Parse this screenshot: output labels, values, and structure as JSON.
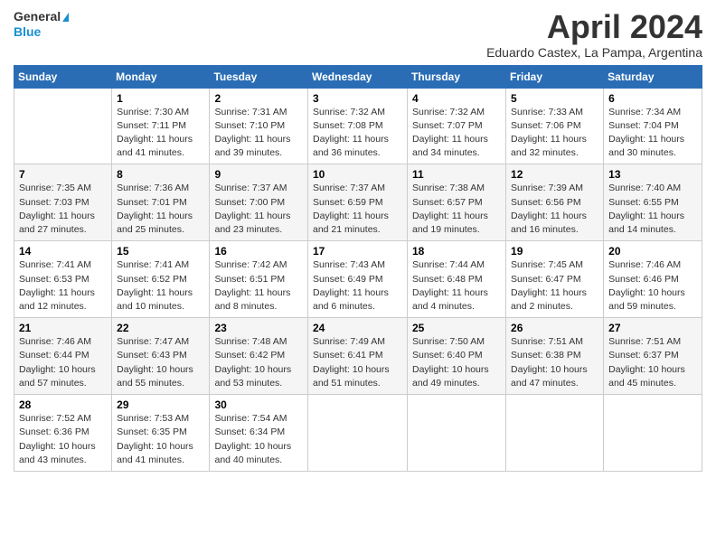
{
  "header": {
    "logo_line1": "General",
    "logo_line2": "Blue",
    "month": "April 2024",
    "location": "Eduardo Castex, La Pampa, Argentina"
  },
  "days_of_week": [
    "Sunday",
    "Monday",
    "Tuesday",
    "Wednesday",
    "Thursday",
    "Friday",
    "Saturday"
  ],
  "weeks": [
    [
      {
        "day": "",
        "info": ""
      },
      {
        "day": "1",
        "info": "Sunrise: 7:30 AM\nSunset: 7:11 PM\nDaylight: 11 hours\nand 41 minutes."
      },
      {
        "day": "2",
        "info": "Sunrise: 7:31 AM\nSunset: 7:10 PM\nDaylight: 11 hours\nand 39 minutes."
      },
      {
        "day": "3",
        "info": "Sunrise: 7:32 AM\nSunset: 7:08 PM\nDaylight: 11 hours\nand 36 minutes."
      },
      {
        "day": "4",
        "info": "Sunrise: 7:32 AM\nSunset: 7:07 PM\nDaylight: 11 hours\nand 34 minutes."
      },
      {
        "day": "5",
        "info": "Sunrise: 7:33 AM\nSunset: 7:06 PM\nDaylight: 11 hours\nand 32 minutes."
      },
      {
        "day": "6",
        "info": "Sunrise: 7:34 AM\nSunset: 7:04 PM\nDaylight: 11 hours\nand 30 minutes."
      }
    ],
    [
      {
        "day": "7",
        "info": "Sunrise: 7:35 AM\nSunset: 7:03 PM\nDaylight: 11 hours\nand 27 minutes."
      },
      {
        "day": "8",
        "info": "Sunrise: 7:36 AM\nSunset: 7:01 PM\nDaylight: 11 hours\nand 25 minutes."
      },
      {
        "day": "9",
        "info": "Sunrise: 7:37 AM\nSunset: 7:00 PM\nDaylight: 11 hours\nand 23 minutes."
      },
      {
        "day": "10",
        "info": "Sunrise: 7:37 AM\nSunset: 6:59 PM\nDaylight: 11 hours\nand 21 minutes."
      },
      {
        "day": "11",
        "info": "Sunrise: 7:38 AM\nSunset: 6:57 PM\nDaylight: 11 hours\nand 19 minutes."
      },
      {
        "day": "12",
        "info": "Sunrise: 7:39 AM\nSunset: 6:56 PM\nDaylight: 11 hours\nand 16 minutes."
      },
      {
        "day": "13",
        "info": "Sunrise: 7:40 AM\nSunset: 6:55 PM\nDaylight: 11 hours\nand 14 minutes."
      }
    ],
    [
      {
        "day": "14",
        "info": "Sunrise: 7:41 AM\nSunset: 6:53 PM\nDaylight: 11 hours\nand 12 minutes."
      },
      {
        "day": "15",
        "info": "Sunrise: 7:41 AM\nSunset: 6:52 PM\nDaylight: 11 hours\nand 10 minutes."
      },
      {
        "day": "16",
        "info": "Sunrise: 7:42 AM\nSunset: 6:51 PM\nDaylight: 11 hours\nand 8 minutes."
      },
      {
        "day": "17",
        "info": "Sunrise: 7:43 AM\nSunset: 6:49 PM\nDaylight: 11 hours\nand 6 minutes."
      },
      {
        "day": "18",
        "info": "Sunrise: 7:44 AM\nSunset: 6:48 PM\nDaylight: 11 hours\nand 4 minutes."
      },
      {
        "day": "19",
        "info": "Sunrise: 7:45 AM\nSunset: 6:47 PM\nDaylight: 11 hours\nand 2 minutes."
      },
      {
        "day": "20",
        "info": "Sunrise: 7:46 AM\nSunset: 6:46 PM\nDaylight: 10 hours\nand 59 minutes."
      }
    ],
    [
      {
        "day": "21",
        "info": "Sunrise: 7:46 AM\nSunset: 6:44 PM\nDaylight: 10 hours\nand 57 minutes."
      },
      {
        "day": "22",
        "info": "Sunrise: 7:47 AM\nSunset: 6:43 PM\nDaylight: 10 hours\nand 55 minutes."
      },
      {
        "day": "23",
        "info": "Sunrise: 7:48 AM\nSunset: 6:42 PM\nDaylight: 10 hours\nand 53 minutes."
      },
      {
        "day": "24",
        "info": "Sunrise: 7:49 AM\nSunset: 6:41 PM\nDaylight: 10 hours\nand 51 minutes."
      },
      {
        "day": "25",
        "info": "Sunrise: 7:50 AM\nSunset: 6:40 PM\nDaylight: 10 hours\nand 49 minutes."
      },
      {
        "day": "26",
        "info": "Sunrise: 7:51 AM\nSunset: 6:38 PM\nDaylight: 10 hours\nand 47 minutes."
      },
      {
        "day": "27",
        "info": "Sunrise: 7:51 AM\nSunset: 6:37 PM\nDaylight: 10 hours\nand 45 minutes."
      }
    ],
    [
      {
        "day": "28",
        "info": "Sunrise: 7:52 AM\nSunset: 6:36 PM\nDaylight: 10 hours\nand 43 minutes."
      },
      {
        "day": "29",
        "info": "Sunrise: 7:53 AM\nSunset: 6:35 PM\nDaylight: 10 hours\nand 41 minutes."
      },
      {
        "day": "30",
        "info": "Sunrise: 7:54 AM\nSunset: 6:34 PM\nDaylight: 10 hours\nand 40 minutes."
      },
      {
        "day": "",
        "info": ""
      },
      {
        "day": "",
        "info": ""
      },
      {
        "day": "",
        "info": ""
      },
      {
        "day": "",
        "info": ""
      }
    ]
  ]
}
